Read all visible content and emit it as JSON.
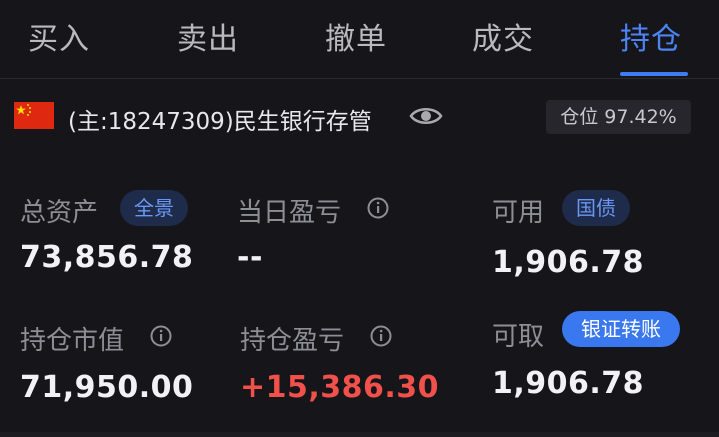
{
  "tabs": [
    {
      "label": "买入"
    },
    {
      "label": "卖出"
    },
    {
      "label": "撤单"
    },
    {
      "label": "成交"
    },
    {
      "label": "持仓",
      "active": true
    }
  ],
  "account": {
    "name": "(主:18247309)民生银行存管",
    "flag_icon": "china-flag-icon",
    "position_label": "仓位 97.42%"
  },
  "metrics": {
    "total_assets": {
      "label": "总资产",
      "value": "73,856.78",
      "pill": "全景"
    },
    "daily_pnl": {
      "label": "当日盈亏",
      "value": "--"
    },
    "available": {
      "label": "可用",
      "value": "1,906.78",
      "pill": "国债"
    },
    "market_value": {
      "label": "持仓市值",
      "value": "71,950.00"
    },
    "position_pnl": {
      "label": "持仓盈亏",
      "value": "+15,386.30"
    },
    "withdrawable": {
      "label": "可取",
      "value": "1,906.78",
      "pill": "银证转账"
    }
  },
  "colors": {
    "accent": "#4d84f4",
    "profit": "#f2504a",
    "background": "#16161a"
  }
}
